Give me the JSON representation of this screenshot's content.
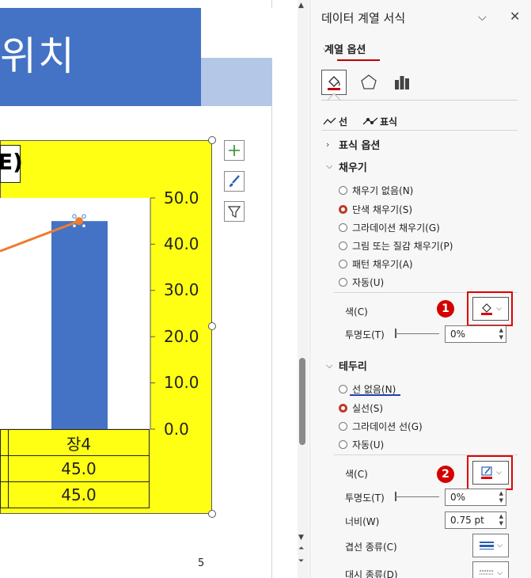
{
  "slide": {
    "title_fragment": "위치",
    "chart_title_fragment": "E)",
    "page_number": "5",
    "y_ticks": [
      "50.0",
      "40.0",
      "30.0",
      "20.0",
      "10.0",
      "0.0"
    ],
    "table": {
      "header": "장4",
      "row1": "45.0",
      "row2": "45.0"
    },
    "colors": {
      "title_band": "#4472c4",
      "accent": "#b4c7e7",
      "chart_fill": "#ffff14",
      "bar": "#4472c4",
      "line": "#ed7d31"
    }
  },
  "chart_data": {
    "type": "bar",
    "categories": [
      "장4"
    ],
    "series": [
      {
        "values": [
          45.0
        ]
      },
      {
        "values": [
          45.0
        ]
      }
    ],
    "ylim": [
      0,
      50
    ],
    "yticks": [
      0,
      10,
      20,
      30,
      40,
      50
    ]
  },
  "pane": {
    "title": "데이터 계열 서식",
    "series_options": "계열 옵션",
    "subtab_line": "선",
    "subtab_marker": "표식",
    "marker_options": "표식 옵션",
    "fill": {
      "heading": "채우기",
      "options": [
        "채우기 없음(N)",
        "단색 채우기(S)",
        "그라데이션 채우기(G)",
        "그림 또는 질감 채우기(P)",
        "패턴 채우기(A)",
        "자동(U)"
      ],
      "selected_index": 1,
      "color_label": "색(C)",
      "transparency_label": "투명도(T)",
      "transparency_value": "0%",
      "badge": "1"
    },
    "border": {
      "heading": "테두리",
      "options": [
        "선 없음(N)",
        "실선(S)",
        "그라데이션 선(G)",
        "자동(U)"
      ],
      "selected_index": 1,
      "color_label": "색(C)",
      "transparency_label": "투명도(T)",
      "transparency_value": "0%",
      "width_label": "너비(W)",
      "width_value": "0.75 pt",
      "compound_label": "겹선 종류(C)",
      "dash_label": "대시 종류(D)",
      "badge": "2"
    }
  }
}
